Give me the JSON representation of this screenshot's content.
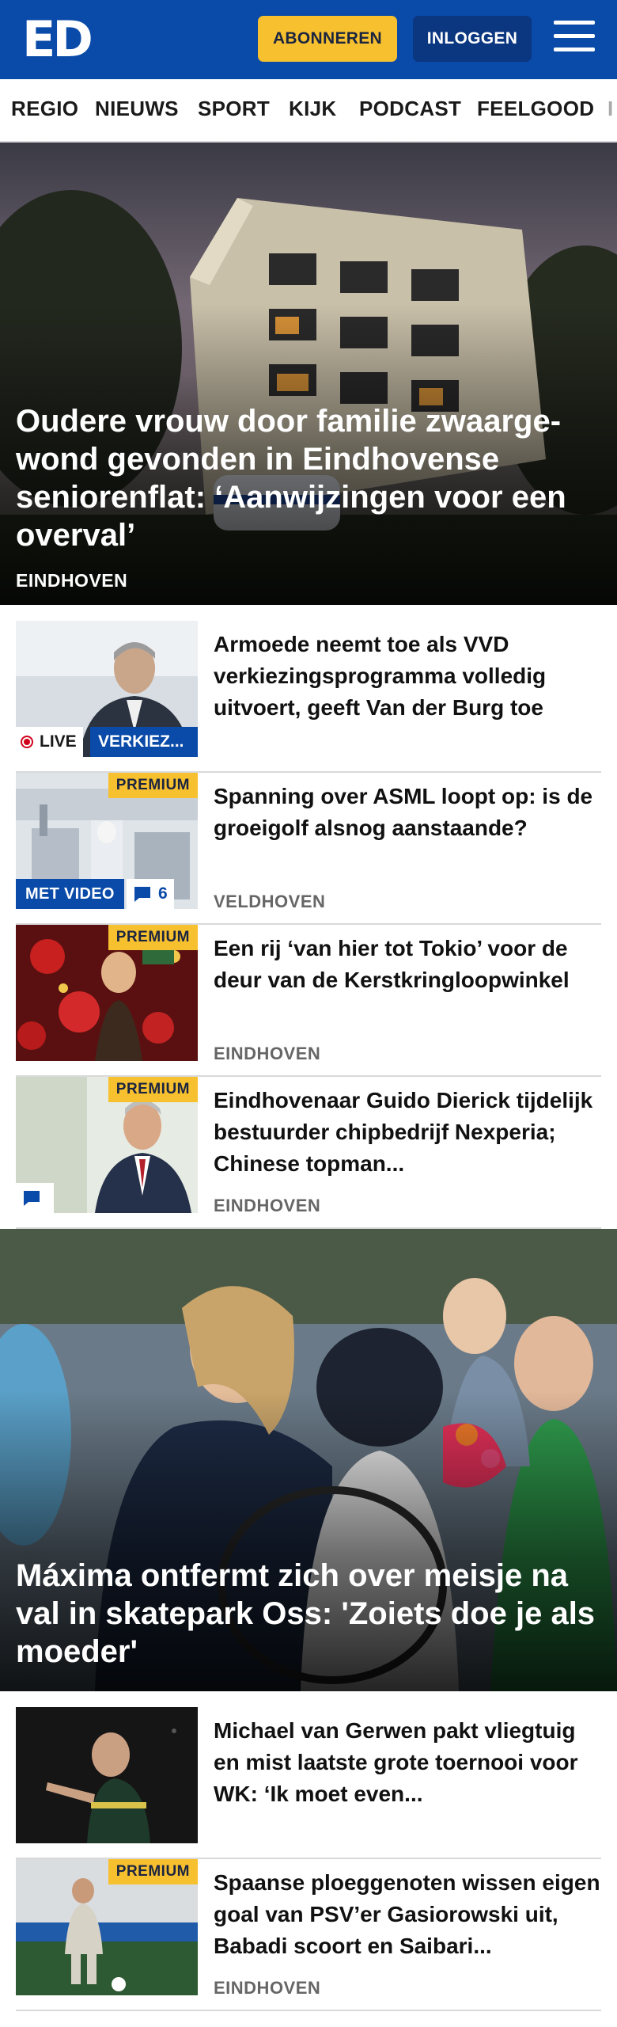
{
  "header": {
    "logo": "ED",
    "subscribe_label": "ABONNEREN",
    "login_label": "INLOGGEN"
  },
  "nav": {
    "items": [
      "REGIO",
      "NIEUWS",
      "SPORT",
      "KIJK",
      "PODCAST",
      "FEELGOOD",
      "I"
    ]
  },
  "hero1": {
    "title": "Oudere vrouw door familie zwaarge­wond gevonden in Eindhovense seniorenflat: ‘Aanwijzingen voor een overval’",
    "tag": "EINDHOVEN"
  },
  "articles": [
    {
      "title": "Armoede neemt toe als VVD verkiezingsprogramma volledig uitvoert, geeft Van der Burg toe",
      "live_label": "LIVE",
      "category": "VERKIEZ..."
    },
    {
      "title": "Spanning over ASML loopt op: is de groeigolf alsnog aanstaande?",
      "premium": "PREMIUM",
      "video_label": "MET VIDEO",
      "comments": "6",
      "location": "VELDHOVEN"
    },
    {
      "title": "Een rij ‘van hier tot Tokio’ voor de deur van de Kerstkringloopwin­kel",
      "premium": "PREMIUM",
      "location": "EINDHOVEN"
    },
    {
      "title": "Eindhovenaar Guido Dierick tijdelijk bestuurder chipbedrijf Nexperia; Chinese topman...",
      "premium": "PREMIUM",
      "location": "EINDHOVEN"
    }
  ],
  "hero2": {
    "title": "Máxima ontfermt zich over meisje na val in skatepark Oss: 'Zoiets doe je als moeder'"
  },
  "articles2": [
    {
      "title": "Michael van Gerwen pakt vliegtuig en mist laatste grote toernooi voor WK: ‘Ik moet even..."
    },
    {
      "title": "Spaanse ploeggenoten wissen eigen goal van PSV’er Gasiorow­ski uit, Babadi scoort en Saibari...",
      "premium": "PREMIUM",
      "location": "EINDHOVEN"
    }
  ],
  "colors": {
    "brand_blue": "#0a4aa8",
    "premium_yellow": "#f7c02f",
    "login_navy": "#0b3680"
  }
}
